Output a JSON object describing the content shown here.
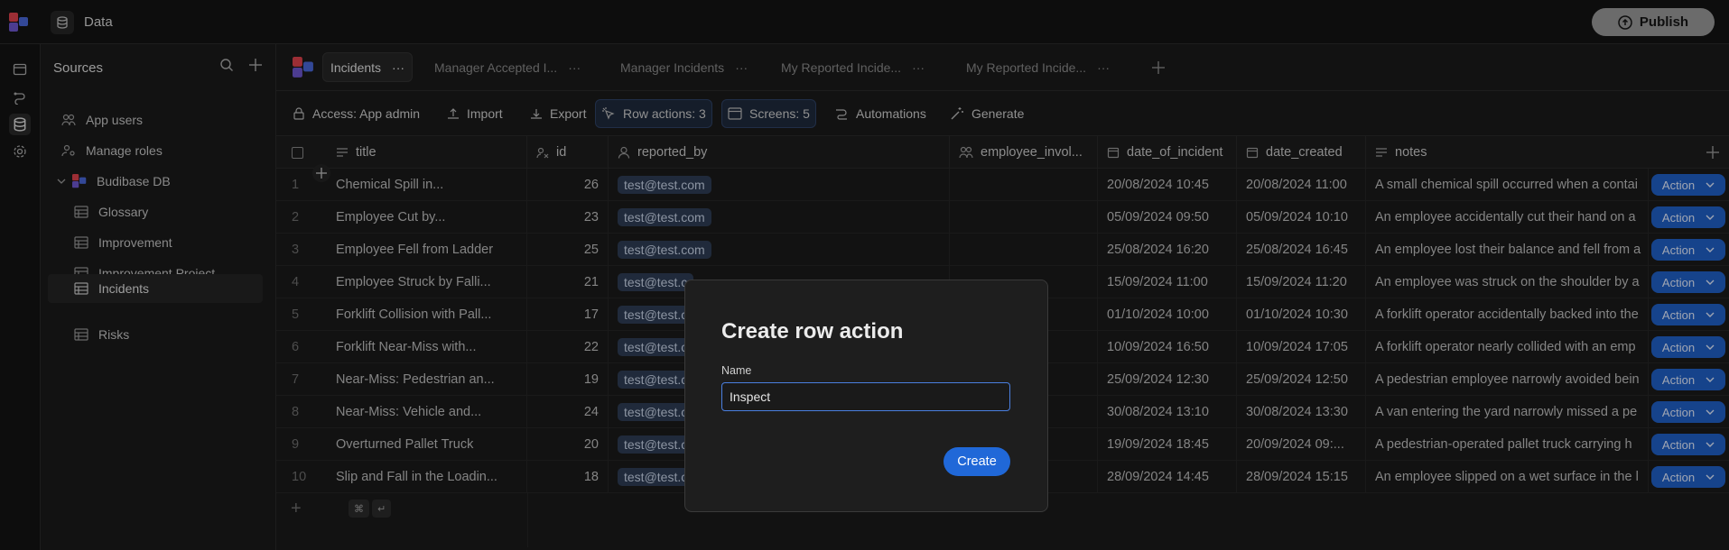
{
  "app": {
    "section_title": "Data",
    "publish_label": "Publish"
  },
  "sidebar": {
    "header": "Sources",
    "items": [
      {
        "label": "App users",
        "icon": "users-icon"
      },
      {
        "label": "Manage roles",
        "icon": "user-cog-icon"
      },
      {
        "label": "Budibase DB",
        "icon": "budibase-db-icon"
      },
      {
        "label": "Glossary",
        "icon": "table-icon"
      },
      {
        "label": "Improvement",
        "icon": "table-icon"
      },
      {
        "label": "Improvement Project",
        "icon": "table-icon"
      },
      {
        "label": "Incidents",
        "icon": "table-icon"
      },
      {
        "label": "Risks",
        "icon": "table-icon"
      }
    ]
  },
  "tabs": [
    {
      "label": "Incidents"
    },
    {
      "label": "Manager Accepted I..."
    },
    {
      "label": "Manager Incidents"
    },
    {
      "label": "My Reported Incide..."
    },
    {
      "label": "My Reported Incide..."
    }
  ],
  "toolbar": {
    "access": "Access: App admin",
    "import": "Import",
    "export": "Export",
    "row_actions": "Row actions: 3",
    "screens": "Screens: 5",
    "automations": "Automations",
    "generate": "Generate"
  },
  "columns": [
    "title",
    "id",
    "reported_by",
    "employee_invol...",
    "date_of_incident",
    "date_created",
    "notes"
  ],
  "rows": [
    {
      "n": "1",
      "title": "Chemical Spill in...",
      "id": "26",
      "reported_by": "test@test.com",
      "date_of_incident": "20/08/2024 10:45",
      "date_created": "20/08/2024 11:00",
      "notes": "A small chemical spill occurred when a contai"
    },
    {
      "n": "2",
      "title": "Employee Cut by...",
      "id": "23",
      "reported_by": "test@test.com",
      "date_of_incident": "05/09/2024 09:50",
      "date_created": "05/09/2024 10:10",
      "notes": "An employee accidentally cut their hand on a"
    },
    {
      "n": "3",
      "title": "Employee Fell from Ladder",
      "id": "25",
      "reported_by": "test@test.com",
      "date_of_incident": "25/08/2024 16:20",
      "date_created": "25/08/2024 16:45",
      "notes": "An employee lost their balance and fell from a"
    },
    {
      "n": "4",
      "title": "Employee Struck by Falli...",
      "id": "21",
      "reported_by": "test@test.c",
      "date_of_incident": "15/09/2024 11:00",
      "date_created": "15/09/2024 11:20",
      "notes": "An employee was struck on the shoulder by a"
    },
    {
      "n": "5",
      "title": "Forklift Collision with Pall...",
      "id": "17",
      "reported_by": "test@test.c",
      "date_of_incident": "01/10/2024 10:00",
      "date_created": "01/10/2024 10:30",
      "notes": "A forklift operator accidentally backed into the"
    },
    {
      "n": "6",
      "title": "Forklift Near-Miss with...",
      "id": "22",
      "reported_by": "test@test.c",
      "date_of_incident": "10/09/2024 16:50",
      "date_created": "10/09/2024 17:05",
      "notes": "A forklift operator nearly collided with an emp"
    },
    {
      "n": "7",
      "title": "Near-Miss: Pedestrian an...",
      "id": "19",
      "reported_by": "test@test.c",
      "date_of_incident": "25/09/2024 12:30",
      "date_created": "25/09/2024 12:50",
      "notes": "A pedestrian employee narrowly avoided bein"
    },
    {
      "n": "8",
      "title": "Near-Miss: Vehicle and...",
      "id": "24",
      "reported_by": "test@test.c",
      "date_of_incident": "30/08/2024 13:10",
      "date_created": "30/08/2024 13:30",
      "notes": "A van entering the yard narrowly missed a pe"
    },
    {
      "n": "9",
      "title": "Overturned Pallet Truck",
      "id": "20",
      "reported_by": "test@test.c",
      "date_of_incident": "19/09/2024 18:45",
      "date_created": "20/09/2024 09:...",
      "notes": "A pedestrian-operated pallet truck carrying h"
    },
    {
      "n": "10",
      "title": "Slip and Fall in the Loadin...",
      "id": "18",
      "reported_by": "test@test.c",
      "date_of_incident": "28/09/2024 14:45",
      "date_created": "28/09/2024 15:15",
      "notes": "An employee slipped on a wet surface in the l"
    }
  ],
  "action_label": "Action",
  "shortcut": {
    "cmd": "⌘",
    "enter": "↵"
  },
  "modal": {
    "title": "Create row action",
    "name_label": "Name",
    "name_value": "Inspect",
    "create_label": "Create"
  }
}
